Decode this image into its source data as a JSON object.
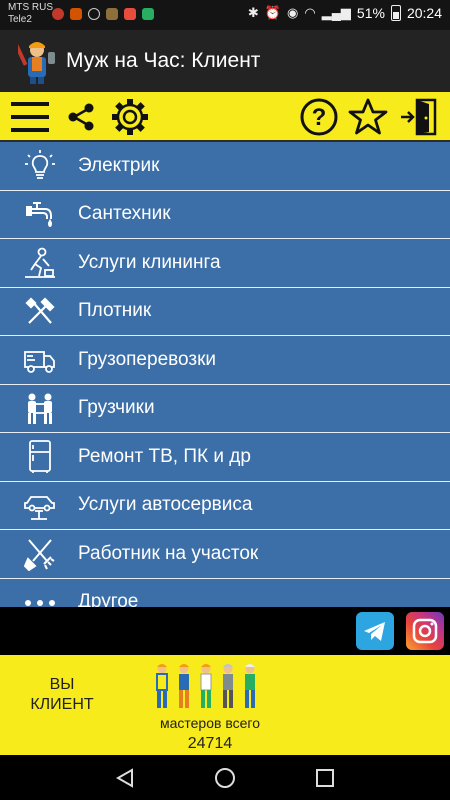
{
  "status_bar": {
    "carrier_1": "MTS RUS",
    "carrier_2": "Tele2",
    "battery": "51%",
    "time": "20:24"
  },
  "app": {
    "title": "Муж на Час: Клиент"
  },
  "toolbar": {
    "icons": [
      "menu-icon",
      "share-icon",
      "gear-icon",
      "help-icon",
      "star-icon",
      "exit-door-icon"
    ]
  },
  "menu": {
    "items": [
      {
        "label": "Электрик",
        "icon": "lightbulb-icon"
      },
      {
        "label": "Сантехник",
        "icon": "faucet-icon"
      },
      {
        "label": "Услуги клининга",
        "icon": "cleaning-icon"
      },
      {
        "label": "Плотник",
        "icon": "tools-icon"
      },
      {
        "label": "Грузоперевозки",
        "icon": "truck-icon"
      },
      {
        "label": "Грузчики",
        "icon": "movers-icon"
      },
      {
        "label": "Ремонт ТВ, ПК и др",
        "icon": "fridge-icon"
      },
      {
        "label": "Услуги автосервиса",
        "icon": "car-lift-icon"
      },
      {
        "label": "Работник на участок",
        "icon": "shovel-rake-icon"
      },
      {
        "label": "Другое",
        "icon": "more-dots-icon"
      }
    ]
  },
  "social": {
    "telegram": "telegram-icon",
    "instagram": "instagram-icon"
  },
  "footer": {
    "you_line1": "ВЫ",
    "you_line2": "КЛИЕНТ",
    "masters_label": "мастеров всего",
    "masters_count": "24714"
  },
  "colors": {
    "yellow": "#f7eb1c",
    "menu_blue": "#3c6fa7",
    "appbar": "#232323"
  }
}
